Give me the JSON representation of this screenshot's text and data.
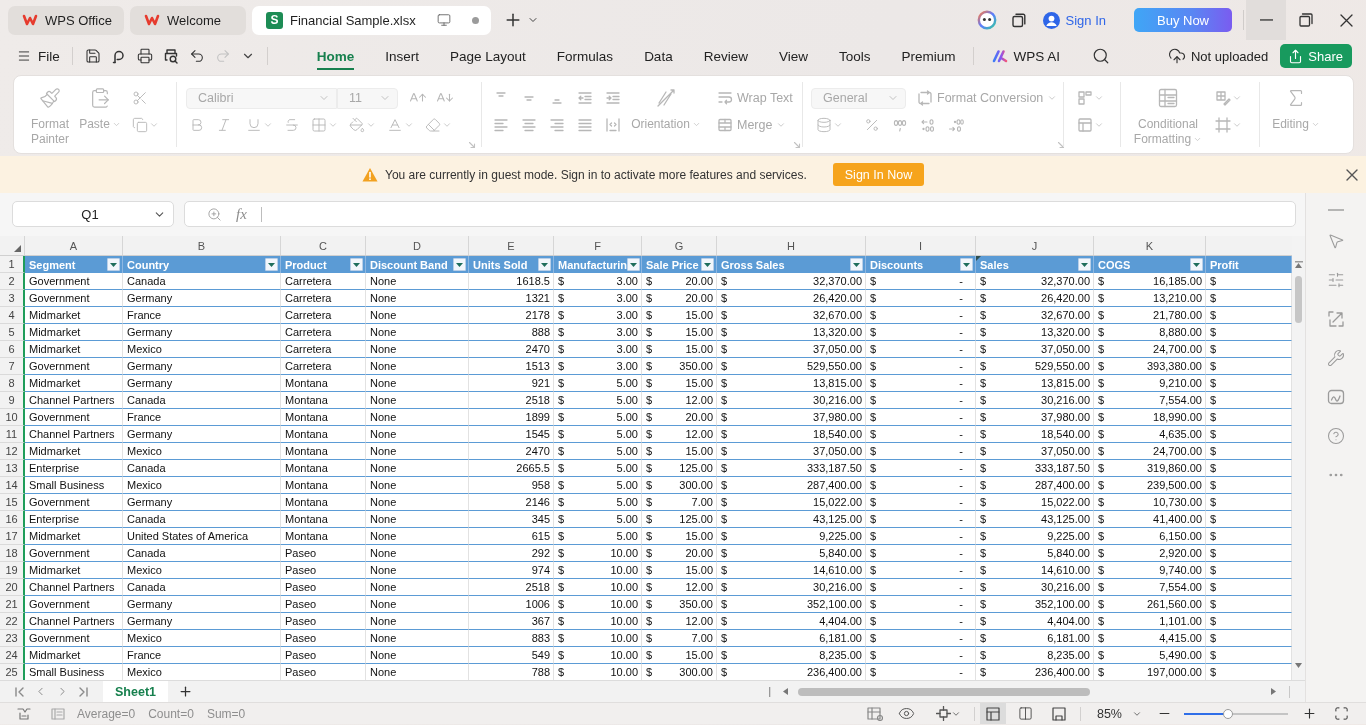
{
  "title_bar": {
    "tabs": [
      {
        "kind": "wps",
        "label": "WPS Office",
        "selected": false,
        "unsaved": false
      },
      {
        "kind": "wps",
        "label": "Welcome",
        "selected": false,
        "unsaved": false
      },
      {
        "kind": "sheet",
        "badge": "S",
        "label": "Financial Sample.xlsx",
        "selected": true,
        "unsaved": true
      }
    ],
    "sign_in": "Sign In",
    "buy": "Buy Now"
  },
  "menu": {
    "file": "File",
    "quick_access": [
      {
        "kind": "save",
        "disabled": false
      },
      {
        "kind": "export_pdf",
        "disabled": false
      },
      {
        "kind": "print",
        "disabled": false
      },
      {
        "kind": "print_preview",
        "disabled": false
      },
      {
        "kind": "undo",
        "disabled": false
      },
      {
        "kind": "redo",
        "disabled": true
      }
    ],
    "tabs": [
      {
        "label": "Home",
        "selected": true
      },
      {
        "label": "Insert",
        "selected": false
      },
      {
        "label": "Page Layout",
        "selected": false
      },
      {
        "label": "Formulas",
        "selected": false
      },
      {
        "label": "Data",
        "selected": false
      },
      {
        "label": "Review",
        "selected": false
      },
      {
        "label": "View",
        "selected": false
      },
      {
        "label": "Tools",
        "selected": false
      },
      {
        "label": "Premium",
        "selected": false
      }
    ],
    "ai": "WPS AI",
    "upload_status": "Not uploaded",
    "share": "Share"
  },
  "ribbon": {
    "disabled": true,
    "format_painter": "Format Painter",
    "paste": "Paste",
    "font": "Calibri",
    "font_size": "11",
    "orientation": "Orientation",
    "wrap_text": "Wrap Text",
    "merge": "Merge",
    "number_format": "General",
    "format_conversion": "Format Conversion",
    "conditional_formatting": "Conditional Formatting",
    "editing": "Editing"
  },
  "notice": {
    "text": "You are currently in guest mode. Sign in to activate more features and services.",
    "button": "Sign In Now"
  },
  "formula_bar": {
    "name_box": "Q1",
    "function_label": "fx"
  },
  "sheet": {
    "columns": [
      "A",
      "B",
      "C",
      "D",
      "E",
      "F",
      "G",
      "H",
      "I",
      "J",
      "K"
    ],
    "header": {
      "number": "1",
      "cells": [
        {
          "label": "Segment",
          "filter": true,
          "marked": false
        },
        {
          "label": "Country",
          "filter": true,
          "marked": false
        },
        {
          "label": "Product",
          "filter": true,
          "marked": false
        },
        {
          "label": "Discount Band",
          "filter": true,
          "marked": false
        },
        {
          "label": "Units Sold",
          "filter": true,
          "marked": false
        },
        {
          "label": "Manufacturin",
          "filter": true,
          "marked": false
        },
        {
          "label": "Sale Price",
          "filter": true,
          "marked": false
        },
        {
          "label": "Gross Sales",
          "filter": true,
          "marked": false
        },
        {
          "label": "Discounts",
          "filter": true,
          "marked": false
        },
        {
          "label": "Sales",
          "filter": true,
          "marked": true
        },
        {
          "label": "COGS",
          "filter": true,
          "marked": false
        },
        {
          "label": "Profit",
          "filter": false,
          "marked": false
        }
      ]
    },
    "rows": [
      {
        "number": "2",
        "cells": [
          "Government",
          "Canada",
          "Carretera",
          "None",
          "1618.5",
          [
            "$",
            "3.00"
          ],
          [
            "$",
            "20.00"
          ],
          [
            "$",
            "32,370.00"
          ],
          [
            "$",
            "-"
          ],
          [
            "$",
            "32,370.00"
          ],
          [
            "$",
            "16,185.00"
          ],
          [
            "$"
          ]
        ]
      },
      {
        "number": "3",
        "cells": [
          "Government",
          "Germany",
          "Carretera",
          "None",
          "1321",
          [
            "$",
            "3.00"
          ],
          [
            "$",
            "20.00"
          ],
          [
            "$",
            "26,420.00"
          ],
          [
            "$",
            "-"
          ],
          [
            "$",
            "26,420.00"
          ],
          [
            "$",
            "13,210.00"
          ],
          [
            "$"
          ]
        ]
      },
      {
        "number": "4",
        "cells": [
          "Midmarket",
          "France",
          "Carretera",
          "None",
          "2178",
          [
            "$",
            "3.00"
          ],
          [
            "$",
            "15.00"
          ],
          [
            "$",
            "32,670.00"
          ],
          [
            "$",
            "-"
          ],
          [
            "$",
            "32,670.00"
          ],
          [
            "$",
            "21,780.00"
          ],
          [
            "$"
          ]
        ]
      },
      {
        "number": "5",
        "cells": [
          "Midmarket",
          "Germany",
          "Carretera",
          "None",
          "888",
          [
            "$",
            "3.00"
          ],
          [
            "$",
            "15.00"
          ],
          [
            "$",
            "13,320.00"
          ],
          [
            "$",
            "-"
          ],
          [
            "$",
            "13,320.00"
          ],
          [
            "$",
            "8,880.00"
          ],
          [
            "$"
          ]
        ]
      },
      {
        "number": "6",
        "cells": [
          "Midmarket",
          "Mexico",
          "Carretera",
          "None",
          "2470",
          [
            "$",
            "3.00"
          ],
          [
            "$",
            "15.00"
          ],
          [
            "$",
            "37,050.00"
          ],
          [
            "$",
            "-"
          ],
          [
            "$",
            "37,050.00"
          ],
          [
            "$",
            "24,700.00"
          ],
          [
            "$"
          ]
        ]
      },
      {
        "number": "7",
        "cells": [
          "Government",
          "Germany",
          "Carretera",
          "None",
          "1513",
          [
            "$",
            "3.00"
          ],
          [
            "$",
            "350.00"
          ],
          [
            "$",
            "529,550.00"
          ],
          [
            "$",
            "-"
          ],
          [
            "$",
            "529,550.00"
          ],
          [
            "$",
            "393,380.00"
          ],
          [
            "$"
          ]
        ]
      },
      {
        "number": "8",
        "cells": [
          "Midmarket",
          "Germany",
          "Montana",
          "None",
          "921",
          [
            "$",
            "5.00"
          ],
          [
            "$",
            "15.00"
          ],
          [
            "$",
            "13,815.00"
          ],
          [
            "$",
            "-"
          ],
          [
            "$",
            "13,815.00"
          ],
          [
            "$",
            "9,210.00"
          ],
          [
            "$"
          ]
        ]
      },
      {
        "number": "9",
        "cells": [
          "Channel Partners",
          "Canada",
          "Montana",
          "None",
          "2518",
          [
            "$",
            "5.00"
          ],
          [
            "$",
            "12.00"
          ],
          [
            "$",
            "30,216.00"
          ],
          [
            "$",
            "-"
          ],
          [
            "$",
            "30,216.00"
          ],
          [
            "$",
            "7,554.00"
          ],
          [
            "$"
          ]
        ]
      },
      {
        "number": "10",
        "cells": [
          "Government",
          "France",
          "Montana",
          "None",
          "1899",
          [
            "$",
            "5.00"
          ],
          [
            "$",
            "20.00"
          ],
          [
            "$",
            "37,980.00"
          ],
          [
            "$",
            "-"
          ],
          [
            "$",
            "37,980.00"
          ],
          [
            "$",
            "18,990.00"
          ],
          [
            "$"
          ]
        ]
      },
      {
        "number": "11",
        "cells": [
          "Channel Partners",
          "Germany",
          "Montana",
          "None",
          "1545",
          [
            "$",
            "5.00"
          ],
          [
            "$",
            "12.00"
          ],
          [
            "$",
            "18,540.00"
          ],
          [
            "$",
            "-"
          ],
          [
            "$",
            "18,540.00"
          ],
          [
            "$",
            "4,635.00"
          ],
          [
            "$"
          ]
        ]
      },
      {
        "number": "12",
        "cells": [
          "Midmarket",
          "Mexico",
          "Montana",
          "None",
          "2470",
          [
            "$",
            "5.00"
          ],
          [
            "$",
            "15.00"
          ],
          [
            "$",
            "37,050.00"
          ],
          [
            "$",
            "-"
          ],
          [
            "$",
            "37,050.00"
          ],
          [
            "$",
            "24,700.00"
          ],
          [
            "$"
          ]
        ]
      },
      {
        "number": "13",
        "cells": [
          "Enterprise",
          "Canada",
          "Montana",
          "None",
          "2665.5",
          [
            "$",
            "5.00"
          ],
          [
            "$",
            "125.00"
          ],
          [
            "$",
            "333,187.50"
          ],
          [
            "$",
            "-"
          ],
          [
            "$",
            "333,187.50"
          ],
          [
            "$",
            "319,860.00"
          ],
          [
            "$"
          ]
        ]
      },
      {
        "number": "14",
        "cells": [
          "Small Business",
          "Mexico",
          "Montana",
          "None",
          "958",
          [
            "$",
            "5.00"
          ],
          [
            "$",
            "300.00"
          ],
          [
            "$",
            "287,400.00"
          ],
          [
            "$",
            "-"
          ],
          [
            "$",
            "287,400.00"
          ],
          [
            "$",
            "239,500.00"
          ],
          [
            "$"
          ]
        ]
      },
      {
        "number": "15",
        "cells": [
          "Government",
          "Germany",
          "Montana",
          "None",
          "2146",
          [
            "$",
            "5.00"
          ],
          [
            "$",
            "7.00"
          ],
          [
            "$",
            "15,022.00"
          ],
          [
            "$",
            "-"
          ],
          [
            "$",
            "15,022.00"
          ],
          [
            "$",
            "10,730.00"
          ],
          [
            "$"
          ]
        ]
      },
      {
        "number": "16",
        "cells": [
          "Enterprise",
          "Canada",
          "Montana",
          "None",
          "345",
          [
            "$",
            "5.00"
          ],
          [
            "$",
            "125.00"
          ],
          [
            "$",
            "43,125.00"
          ],
          [
            "$",
            "-"
          ],
          [
            "$",
            "43,125.00"
          ],
          [
            "$",
            "41,400.00"
          ],
          [
            "$"
          ]
        ]
      },
      {
        "number": "17",
        "cells": [
          "Midmarket",
          "United States of America",
          "Montana",
          "None",
          "615",
          [
            "$",
            "5.00"
          ],
          [
            "$",
            "15.00"
          ],
          [
            "$",
            "9,225.00"
          ],
          [
            "$",
            "-"
          ],
          [
            "$",
            "9,225.00"
          ],
          [
            "$",
            "6,150.00"
          ],
          [
            "$"
          ]
        ]
      },
      {
        "number": "18",
        "cells": [
          "Government",
          "Canada",
          "Paseo",
          "None",
          "292",
          [
            "$",
            "10.00"
          ],
          [
            "$",
            "20.00"
          ],
          [
            "$",
            "5,840.00"
          ],
          [
            "$",
            "-"
          ],
          [
            "$",
            "5,840.00"
          ],
          [
            "$",
            "2,920.00"
          ],
          [
            "$"
          ]
        ]
      },
      {
        "number": "19",
        "cells": [
          "Midmarket",
          "Mexico",
          "Paseo",
          "None",
          "974",
          [
            "$",
            "10.00"
          ],
          [
            "$",
            "15.00"
          ],
          [
            "$",
            "14,610.00"
          ],
          [
            "$",
            "-"
          ],
          [
            "$",
            "14,610.00"
          ],
          [
            "$",
            "9,740.00"
          ],
          [
            "$"
          ]
        ]
      },
      {
        "number": "20",
        "cells": [
          "Channel Partners",
          "Canada",
          "Paseo",
          "None",
          "2518",
          [
            "$",
            "10.00"
          ],
          [
            "$",
            "12.00"
          ],
          [
            "$",
            "30,216.00"
          ],
          [
            "$",
            "-"
          ],
          [
            "$",
            "30,216.00"
          ],
          [
            "$",
            "7,554.00"
          ],
          [
            "$"
          ]
        ]
      },
      {
        "number": "21",
        "cells": [
          "Government",
          "Germany",
          "Paseo",
          "None",
          "1006",
          [
            "$",
            "10.00"
          ],
          [
            "$",
            "350.00"
          ],
          [
            "$",
            "352,100.00"
          ],
          [
            "$",
            "-"
          ],
          [
            "$",
            "352,100.00"
          ],
          [
            "$",
            "261,560.00"
          ],
          [
            "$"
          ]
        ]
      },
      {
        "number": "22",
        "cells": [
          "Channel Partners",
          "Germany",
          "Paseo",
          "None",
          "367",
          [
            "$",
            "10.00"
          ],
          [
            "$",
            "12.00"
          ],
          [
            "$",
            "4,404.00"
          ],
          [
            "$",
            "-"
          ],
          [
            "$",
            "4,404.00"
          ],
          [
            "$",
            "1,101.00"
          ],
          [
            "$"
          ]
        ]
      },
      {
        "number": "23",
        "cells": [
          "Government",
          "Mexico",
          "Paseo",
          "None",
          "883",
          [
            "$",
            "10.00"
          ],
          [
            "$",
            "7.00"
          ],
          [
            "$",
            "6,181.00"
          ],
          [
            "$",
            "-"
          ],
          [
            "$",
            "6,181.00"
          ],
          [
            "$",
            "4,415.00"
          ],
          [
            "$"
          ]
        ]
      },
      {
        "number": "24",
        "cells": [
          "Midmarket",
          "France",
          "Paseo",
          "None",
          "549",
          [
            "$",
            "10.00"
          ],
          [
            "$",
            "15.00"
          ],
          [
            "$",
            "8,235.00"
          ],
          [
            "$",
            "-"
          ],
          [
            "$",
            "8,235.00"
          ],
          [
            "$",
            "5,490.00"
          ],
          [
            "$"
          ]
        ]
      },
      {
        "number": "25",
        "cells": [
          "Small Business",
          "Mexico",
          "Paseo",
          "None",
          "788",
          [
            "$",
            "10.00"
          ],
          [
            "$",
            "300.00"
          ],
          [
            "$",
            "236,400.00"
          ],
          [
            "$",
            "-"
          ],
          [
            "$",
            "236,400.00"
          ],
          [
            "$",
            "197,000.00"
          ],
          [
            "$"
          ]
        ]
      }
    ]
  },
  "sheet_tabs": [
    {
      "label": "Sheet1",
      "selected": true
    }
  ],
  "status_bar": {
    "stats": [
      "Average=0",
      "Count=0",
      "Sum=0"
    ],
    "views": [
      {
        "kind": "normal",
        "selected": true
      },
      {
        "kind": "page_layout",
        "selected": false
      },
      {
        "kind": "page_break",
        "selected": false
      }
    ],
    "zoom": "85%",
    "zoom_slider": {
      "level": 0.42
    }
  }
}
